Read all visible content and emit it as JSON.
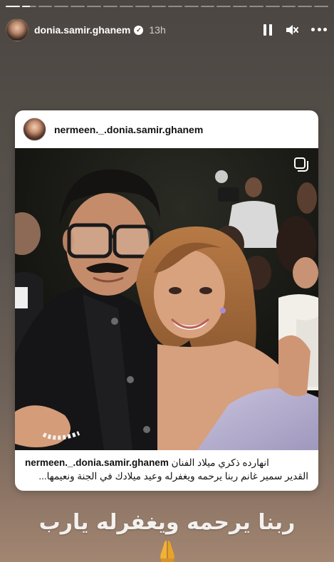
{
  "story": {
    "progress_segments": [
      1,
      0.55,
      0,
      0,
      0,
      0,
      0,
      0,
      0,
      0,
      0,
      0,
      0,
      0,
      0,
      0,
      0,
      0,
      0,
      0
    ]
  },
  "header": {
    "username": "donia.samir.ghanem",
    "verified_icon": "verified-badge-icon",
    "time": "13h",
    "controls": [
      "pause-icon",
      "mute-icon",
      "more-options-icon"
    ]
  },
  "shared_post": {
    "author": "nermeen._.donia.samir.ghanem",
    "multi_photo_icon": "carousel-icon",
    "caption_user": "nermeen._.donia.samir.ghanem",
    "caption_line1": "انهارده ذكري ميلاد الفنان",
    "caption_line2": "القدير سمير غانم ربنا يرحمه ويغفرله وعيد ميلادك في الجنة ونعيمها..."
  },
  "sticker": {
    "text": "ربنا يرحمه ويغفرله يارب",
    "emoji": "folded-hands-icon"
  },
  "colors": {
    "background_top": "#4b4642",
    "background_bottom": "#a38672",
    "card": "#ffffff",
    "emoji": "#f2b233"
  }
}
